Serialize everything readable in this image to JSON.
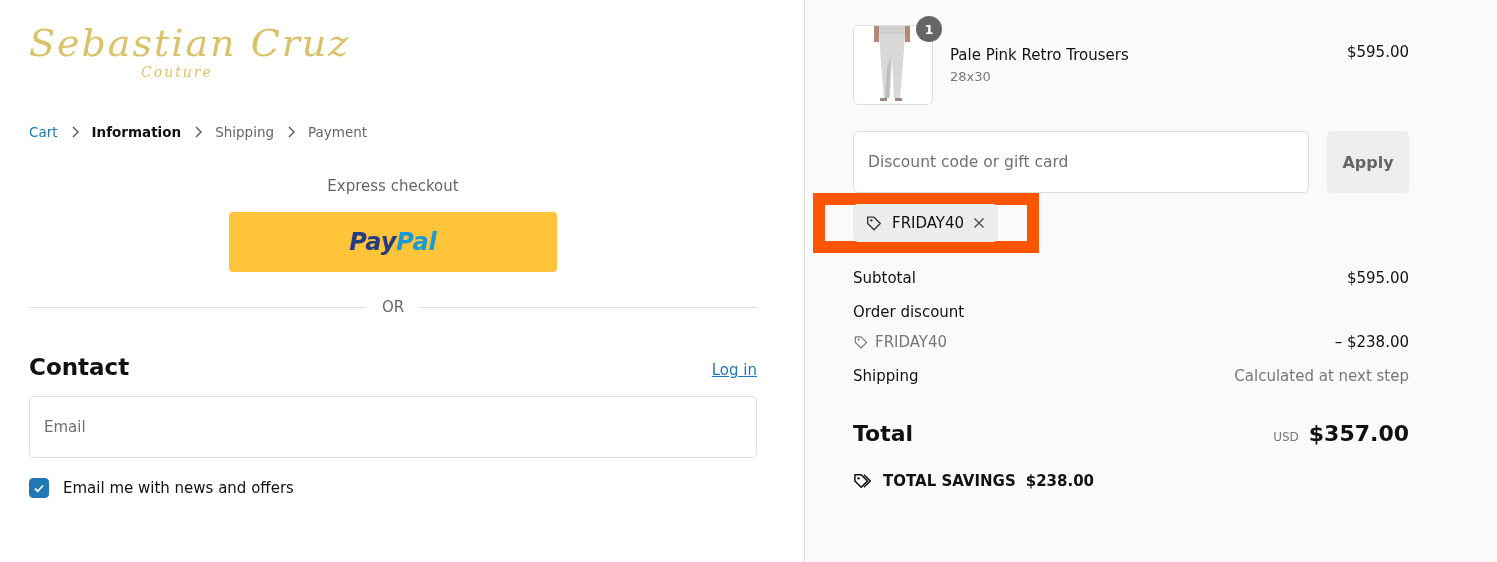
{
  "logo": {
    "name": "Sebastian Cruz",
    "tagline": "Couture"
  },
  "breadcrumbs": [
    {
      "label": "Cart",
      "kind": "link"
    },
    {
      "label": "Information",
      "kind": "current"
    },
    {
      "label": "Shipping",
      "kind": "upcoming"
    },
    {
      "label": "Payment",
      "kind": "upcoming"
    }
  ],
  "express": {
    "title": "Express checkout",
    "paypal": {
      "pay": "Pay",
      "pal": "Pal"
    },
    "divider": "OR"
  },
  "contact": {
    "title": "Contact",
    "login": "Log in",
    "email": {
      "placeholder": "Email"
    },
    "newsletter": {
      "label": "Email me with news and offers",
      "checked": true
    }
  },
  "cart": {
    "item": {
      "name": "Pale Pink Retro Trousers",
      "variant": "28x30",
      "price": "$595.00",
      "quantity": "1"
    },
    "discount": {
      "placeholder": "Discount code or gift card",
      "button": "Apply",
      "applied": "FRIDAY40",
      "highlighted": true
    },
    "subtotal": {
      "label": "Subtotal",
      "value": "$595.00"
    },
    "order_discount": {
      "label": "Order discount",
      "code": "FRIDAY40",
      "value": "– $238.00"
    },
    "shipping": {
      "label": "Shipping",
      "value": "Calculated at next step"
    },
    "total": {
      "label": "Total",
      "currency": "USD",
      "value": "$357.00"
    },
    "savings": {
      "label": "TOTAL SAVINGS",
      "value": "$238.00"
    }
  }
}
